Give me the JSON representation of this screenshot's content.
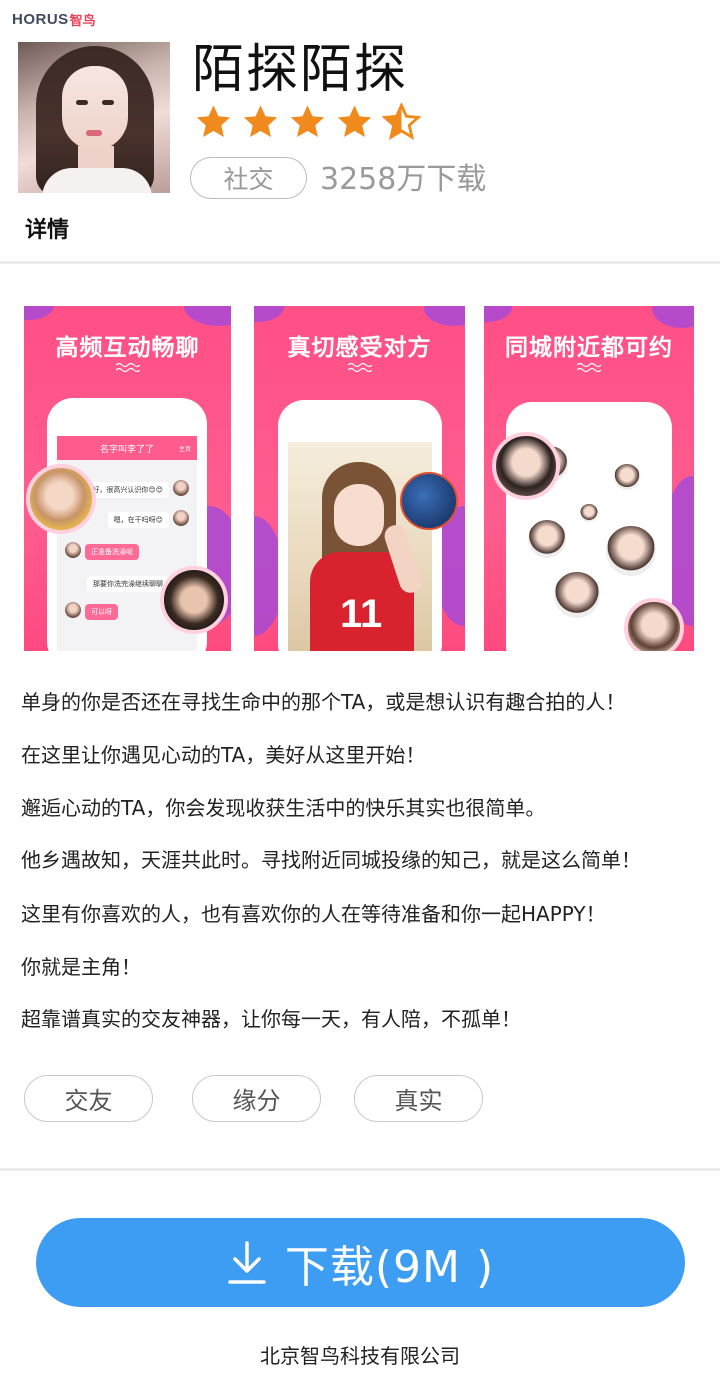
{
  "brand": {
    "name": "HORUS",
    "name_cn": "智鸟"
  },
  "app": {
    "name": "陌探陌探",
    "rating": 4.5,
    "rating_max": 5,
    "category": "社交",
    "downloads": "3258万下载"
  },
  "details_label": "详情",
  "screenshots": [
    {
      "title": "高频互动畅聊",
      "chat_header": "名字叫李了了",
      "chat_header_right": "主页",
      "messages": [
        {
          "side": "right",
          "text": "好，很高兴认识你😊😊"
        },
        {
          "side": "right",
          "text": "嗯，在干吗呀😊"
        },
        {
          "side": "left",
          "text": "正准备洗澡呢"
        },
        {
          "side": "right",
          "text": "那要你洗完澡继续聊聊"
        },
        {
          "side": "left",
          "text": "可以呀"
        }
      ]
    },
    {
      "title": "真切感受对方",
      "jersey_number": "11"
    },
    {
      "title": "同城附近都可约"
    }
  ],
  "description": [
    "单身的你是否还在寻找生命中的那个TA，或是想认识有趣合拍的人！",
    "在这里让你遇见心动的TA，美好从这里开始！",
    "邂逅心动的TA，你会发现收获生活中的快乐其实也很简单。",
    "他乡遇故知，天涯共此时。寻找附近同城投缘的知己，就是这么简单！",
    "这里有你喜欢的人，也有喜欢你的人在等待准备和你一起HAPPY！",
    "你就是主角！",
    "超靠谱真实的交友神器，让你每一天，有人陪，不孤单！"
  ],
  "tags": [
    "交友",
    "缘分",
    "真实"
  ],
  "download_button": {
    "label": "下载(9M )",
    "color": "#3d9df2"
  },
  "company": "北京智鸟科技有限公司",
  "colors": {
    "star": "#f08a1c",
    "screenshot_bg": "#ff5b8d",
    "accent_purple": "#a84ad6"
  }
}
